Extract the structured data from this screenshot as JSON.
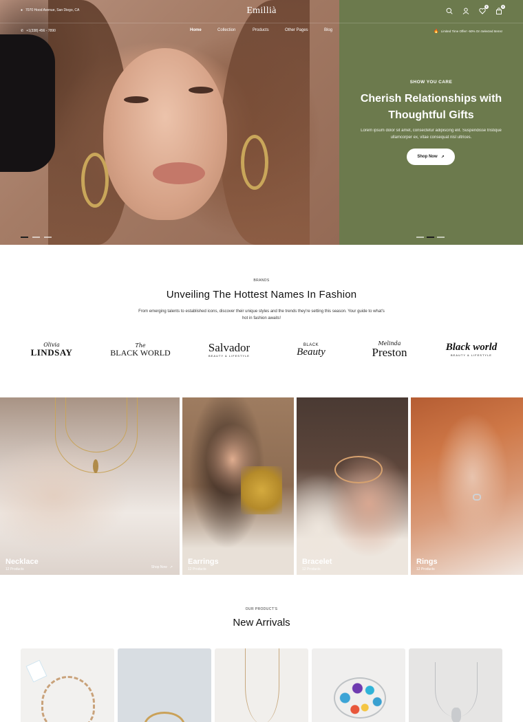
{
  "header": {
    "address": "7070 Hood Avenue, San Diego, CA",
    "logo": "Emillià",
    "phone": "+1(338) 456 - 7890",
    "nav": [
      "Home",
      "Collection",
      "Products",
      "Other Pages",
      "Blog"
    ],
    "active_nav": "Home",
    "offer": "Limited Time Offer! -50% On Selected Items!",
    "wishlist_count": "0",
    "cart_count": "0",
    "icons": [
      "search-icon",
      "user-icon",
      "heart-icon",
      "bag-icon"
    ]
  },
  "hero": {
    "kicker": "SHOW YOU CARE",
    "title": "Cherish Relationships with Thoughtful Gifts",
    "description": "Lorem ipsum dolor sit amet, consectetur adipiscing elit. Suspendisse tristique ullamcorper ex, vitae consequat nisl ultrices.",
    "button": "Shop Now",
    "panel_color": "#6c7a4d"
  },
  "brands": {
    "kicker": "BRANDS",
    "title": "Unveiling The Hottest Names In Fashion",
    "description": "From emerging talents to established icons, discover their unique styles and the trends they're setting this season. Your guide to what's hot in fashion awaits!",
    "logos": [
      {
        "script": "Olivia",
        "main": "LINDSAY",
        "sub": ""
      },
      {
        "script": "The",
        "main": "BLACK WORLD",
        "sub": ""
      },
      {
        "script": "",
        "main": "Salvador",
        "sub": "BEAUTY & LIFESTYLE"
      },
      {
        "script": "BLACK",
        "main": "Beauty",
        "sub": ""
      },
      {
        "script": "Melinda",
        "main": "Preston",
        "sub": ""
      },
      {
        "script": "",
        "main": "Black world",
        "sub": "BEAUTY & LIFESTYLE"
      }
    ]
  },
  "categories": [
    {
      "name": "Necklace",
      "count": "12 Products",
      "shop": "Shop Now"
    },
    {
      "name": "Earrings",
      "count": "12 Products"
    },
    {
      "name": "Bracelet",
      "count": "12 Products"
    },
    {
      "name": "Rings",
      "count": "12 Products"
    }
  ],
  "arrivals": {
    "kicker": "OUR PRODUCT'S",
    "title": "New Arrivals"
  }
}
